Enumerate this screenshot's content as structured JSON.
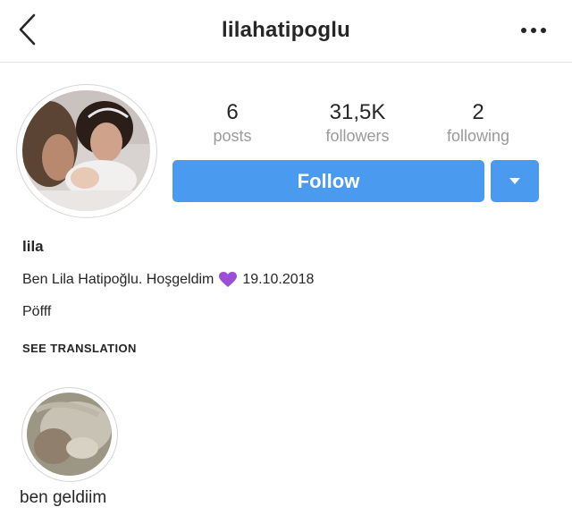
{
  "header": {
    "username": "lilahatipoglu"
  },
  "stats": {
    "posts": {
      "value": "6",
      "label": "posts"
    },
    "followers": {
      "value": "31,5K",
      "label": "followers"
    },
    "following": {
      "value": "2",
      "label": "following"
    }
  },
  "actions": {
    "follow_label": "Follow"
  },
  "profile": {
    "name": "lila",
    "bio_text": "Ben Lila Hatipoğlu. Hoşgeldim",
    "bio_date": "19.10.2018",
    "bio_line2": "Pöfff",
    "see_translation": "SEE TRANSLATION"
  },
  "highlights": [
    {
      "label": "ben geldiim"
    }
  ],
  "colors": {
    "accent": "#4a9bf0",
    "heart": "#9b4fd6"
  },
  "icons": {
    "back": "chevron-left-icon",
    "more": "more-horizontal-icon",
    "dropdown": "caret-down-icon",
    "emoji": "purple-heart-icon"
  }
}
